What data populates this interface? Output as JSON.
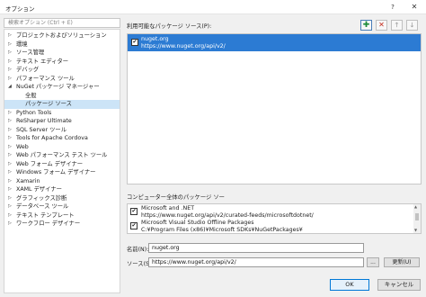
{
  "window": {
    "title": "オプション",
    "help": "?",
    "close": "✕"
  },
  "search": {
    "placeholder": "検索オプション (Ctrl + E)"
  },
  "tree": [
    {
      "label": "プロジェクトおよびソリューション",
      "expandable": true
    },
    {
      "label": "環境",
      "expandable": true
    },
    {
      "label": "ソース管理",
      "expandable": true
    },
    {
      "label": "テキスト エディター",
      "expandable": true
    },
    {
      "label": "デバッグ",
      "expandable": true
    },
    {
      "label": "パフォーマンス ツール",
      "expandable": true
    },
    {
      "label": "NuGet パッケージ マネージャー",
      "expanded": true
    },
    {
      "label": "全般",
      "child": true
    },
    {
      "label": "パッケージ ソース",
      "child": true,
      "selected": true
    },
    {
      "label": "Python Tools",
      "expandable": true
    },
    {
      "label": "ReSharper Ultimate",
      "expandable": true
    },
    {
      "label": "SQL Server ツール",
      "expandable": true
    },
    {
      "label": "Tools for Apache Cordova",
      "expandable": true
    },
    {
      "label": "Web",
      "expandable": true
    },
    {
      "label": "Web パフォーマンス テスト ツール",
      "expandable": true
    },
    {
      "label": "Web フォーム デザイナー",
      "expandable": true
    },
    {
      "label": "Windows フォーム デザイナー",
      "expandable": true
    },
    {
      "label": "Xamarin",
      "expandable": true
    },
    {
      "label": "XAML デザイナー",
      "expandable": true
    },
    {
      "label": "グラフィックス診断",
      "expandable": true
    },
    {
      "label": "データベース ツール",
      "expandable": true
    },
    {
      "label": "テキスト テンプレート",
      "expandable": true
    },
    {
      "label": "ワークフロー デザイナー",
      "expandable": true
    }
  ],
  "available": {
    "label": "利用可能なパッケージ ソース(P):",
    "toolbar": {
      "add": "✚",
      "remove": "✕",
      "up": "🡑",
      "down": "🡓"
    },
    "sources": [
      {
        "name": "nuget.org",
        "url": "https://www.nuget.org/api/v2/",
        "checked": "✔"
      }
    ]
  },
  "machine": {
    "label": "コンピューター全体のパッケージ ソー",
    "sources": [
      {
        "name": "Microsoft and .NET",
        "url": "https://www.nuget.org/api/v2/curated-feeds/microsoftdotnet/",
        "checked": "✔"
      },
      {
        "name": "Microsoft Visual Studio Offline Packages",
        "url": "C:¥Program Files (x86)¥Microsoft SDKs¥NuGetPackages¥",
        "checked": "✔"
      }
    ]
  },
  "form": {
    "name_label": "名前(N):",
    "name_value": "nuget.org",
    "source_label": "ソース(S):",
    "source_value": "https://www.nuget.org/api/v2/",
    "browse": "...",
    "update": "更新(U)"
  },
  "footer": {
    "ok": "OK",
    "cancel": "キャンセル"
  },
  "colors": {
    "selection": "#2c7bd3",
    "tree_selection": "#cce4f7",
    "add_green": "#1e8c3a",
    "remove_red": "#c42b1c"
  }
}
